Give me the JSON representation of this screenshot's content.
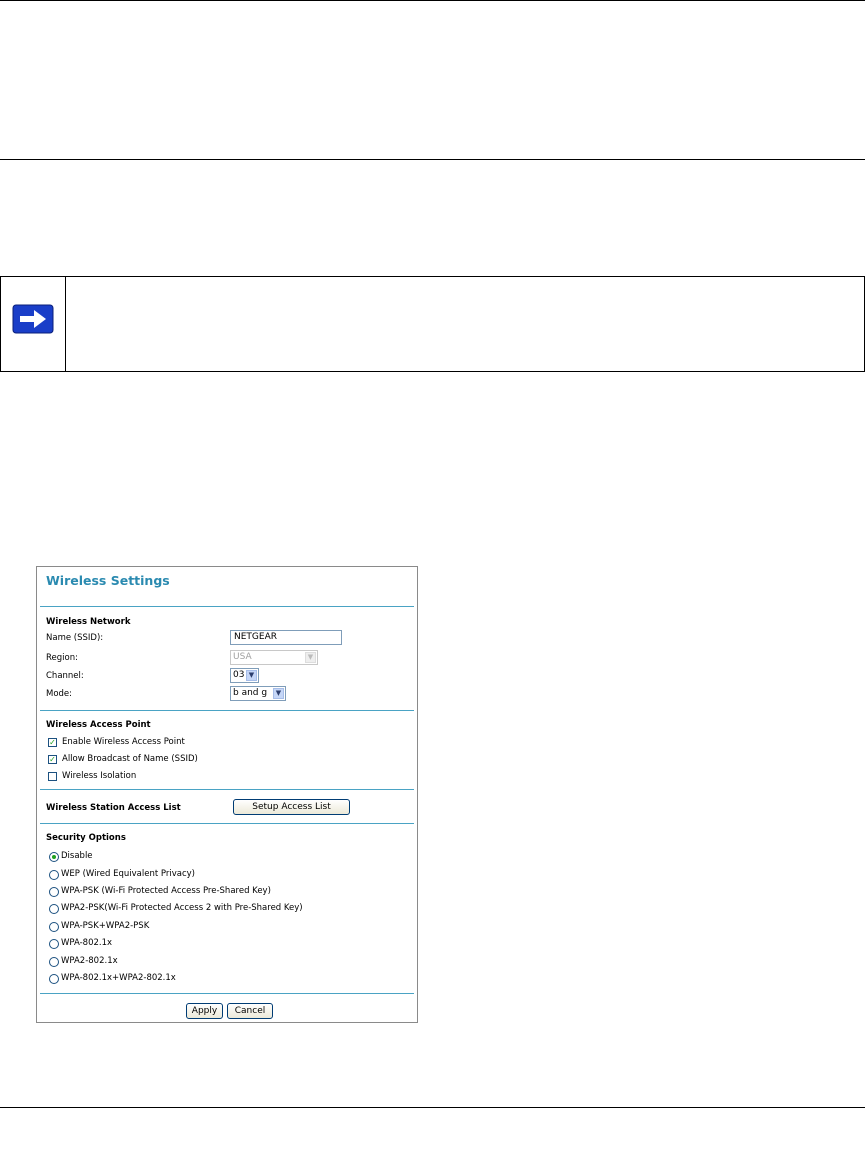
{
  "panel": {
    "title": "Wireless Settings",
    "wireless_network": {
      "heading": "Wireless Network",
      "name_label": "Name (SSID):",
      "name_value": "NETGEAR",
      "region_label": "Region:",
      "region_value": "USA",
      "channel_label": "Channel:",
      "channel_value": "03",
      "mode_label": "Mode:",
      "mode_value": "b and g"
    },
    "access_point": {
      "heading": "Wireless Access Point",
      "options": [
        {
          "label": "Enable Wireless Access Point",
          "checked": true
        },
        {
          "label": "Allow Broadcast of Name (SSID)",
          "checked": true
        },
        {
          "label": "Wireless Isolation",
          "checked": false
        }
      ]
    },
    "station_access": {
      "label": "Wireless Station Access List",
      "button": "Setup Access List"
    },
    "security": {
      "heading": "Security Options",
      "options": [
        {
          "label": "Disable",
          "selected": true
        },
        {
          "label": "WEP (Wired Equivalent Privacy)",
          "selected": false
        },
        {
          "label": "WPA-PSK (Wi-Fi Protected Access Pre-Shared Key)",
          "selected": false
        },
        {
          "label": "WPA2-PSK(Wi-Fi Protected Access 2 with Pre-Shared Key)",
          "selected": false
        },
        {
          "label": "WPA-PSK+WPA2-PSK",
          "selected": false
        },
        {
          "label": "WPA-802.1x",
          "selected": false
        },
        {
          "label": "WPA2-802.1x",
          "selected": false
        },
        {
          "label": "WPA-802.1x+WPA2-802.1x",
          "selected": false
        }
      ]
    },
    "buttons": {
      "apply": "Apply",
      "cancel": "Cancel"
    }
  },
  "icons": {
    "note": "arrow-right-icon"
  },
  "colors": {
    "title": "#2a8ab0",
    "divider": "#4aa3c4",
    "note_arrow_bg": "#1a3ec8"
  }
}
